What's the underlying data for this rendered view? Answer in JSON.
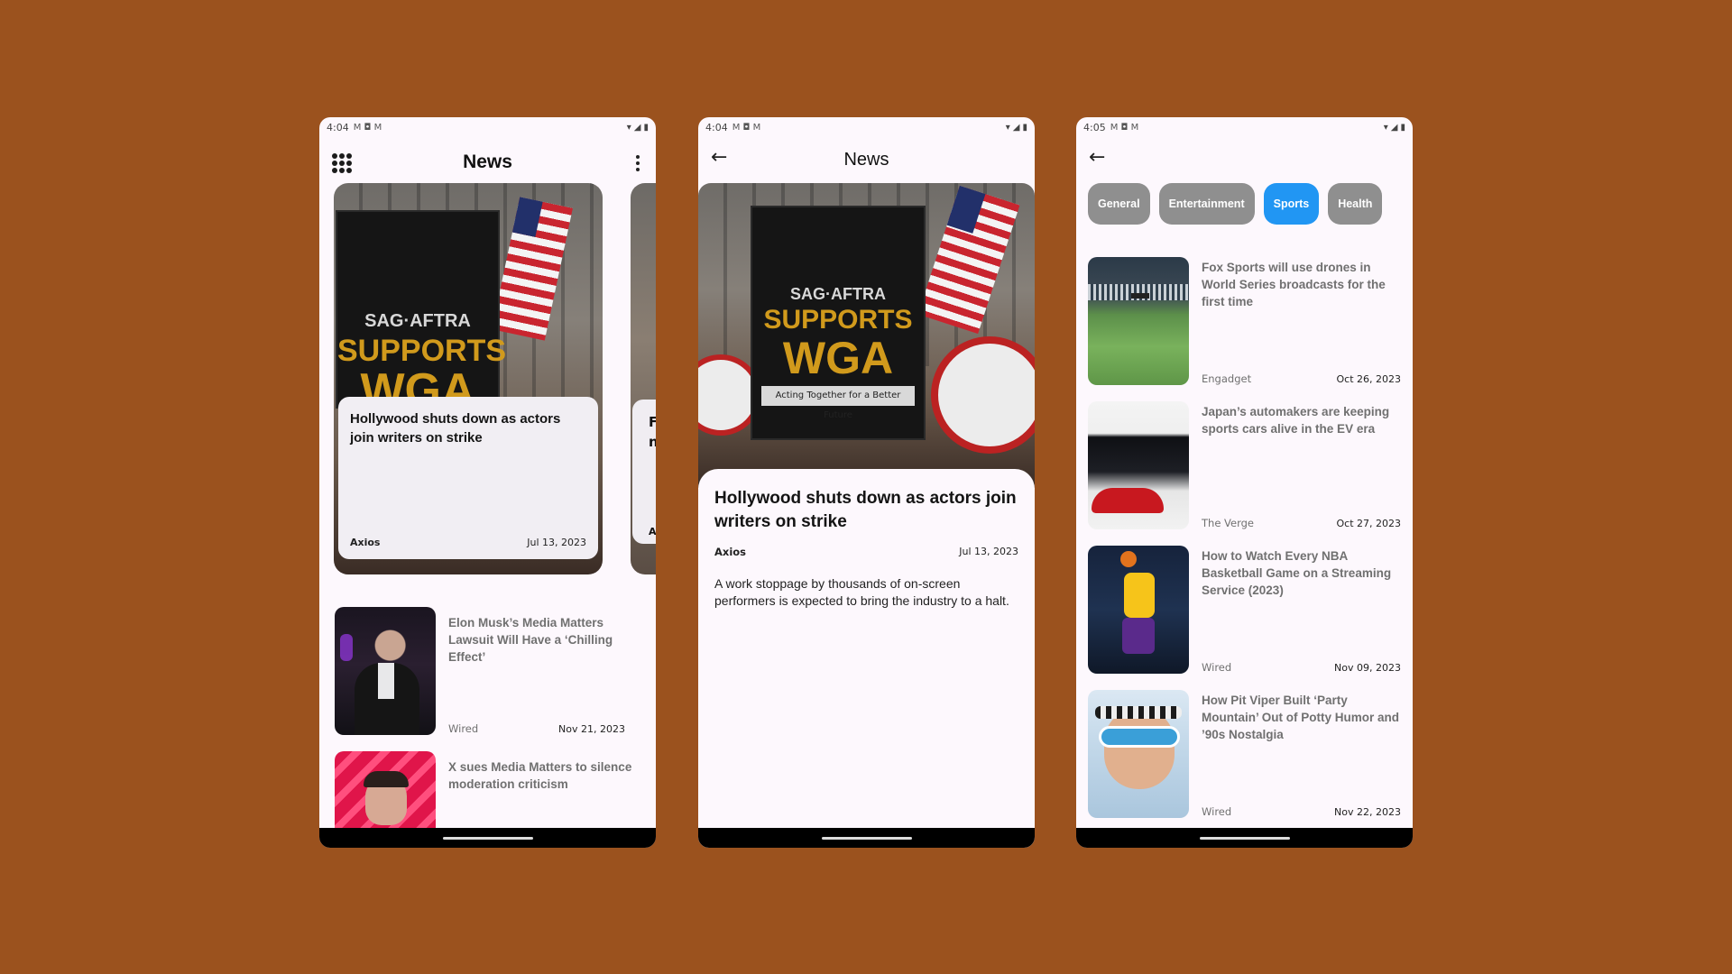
{
  "phones": {
    "home": {
      "status": {
        "time": "4:04",
        "icons": "M ◘ M"
      },
      "title": "News",
      "hero": {
        "title": "Hollywood shuts down as actors join writers on strike",
        "source": "Axios",
        "date": "Jul 13, 2023",
        "sign_top": "SAG·AFTRA",
        "sign_mid": "SUPPORTS",
        "sign_bottom": "WGA"
      },
      "peek_letters": [
        "F",
        "n",
        "A"
      ],
      "list": [
        {
          "title": "Elon Musk’s Media Matters Lawsuit Will Have a ‘Chilling Effect’",
          "source": "Wired",
          "date": "Nov 21, 2023"
        },
        {
          "title": "X sues Media Matters to silence moderation criticism",
          "source": "",
          "date": ""
        }
      ]
    },
    "detail": {
      "status": {
        "time": "4:04",
        "icons": "M ◘ M"
      },
      "title": "News",
      "sign_top": "SAG·AFTRA",
      "sign_mid": "SUPPORTS",
      "sign_bottom": "WGA",
      "sign_caption": "Acting Together for a Better Future",
      "article": {
        "title": "Hollywood shuts down as actors join writers on strike",
        "source": "Axios",
        "date": "Jul 13, 2023",
        "description": "A work stoppage by thousands of on-screen performers is expected to bring the industry to a halt."
      }
    },
    "categories": {
      "status": {
        "time": "4:05",
        "icons": "M ◘ M"
      },
      "chips": [
        {
          "label": "General",
          "active": false
        },
        {
          "label": "Entertainment",
          "active": false
        },
        {
          "label": "Sports",
          "active": true
        },
        {
          "label": "Health",
          "active": false
        }
      ],
      "list": [
        {
          "title": "Fox Sports will use drones in World Series broadcasts for the first time",
          "source": "Engadget",
          "date": "Oct 26, 2023"
        },
        {
          "title": "Japan’s automakers are keeping sports cars alive in the EV era",
          "source": "The Verge",
          "date": "Oct 27, 2023"
        },
        {
          "title": "How to Watch Every NBA Basketball Game on a Streaming Service (2023)",
          "source": "Wired",
          "date": "Nov 09, 2023"
        },
        {
          "title": "How Pit Viper Built ‘Party Mountain’ Out of Potty Humor and ’90s Nostalgia",
          "source": "Wired",
          "date": "Nov 22, 2023"
        }
      ]
    }
  },
  "colors": {
    "background": "#9b521e",
    "accent": "#2196f3",
    "chip": "#8f8f8f"
  },
  "icons": {
    "menu": "grid-icon",
    "more": "kebab-icon",
    "back": "back-arrow-icon",
    "wifi": "wifi-icon",
    "battery": "battery-icon"
  }
}
